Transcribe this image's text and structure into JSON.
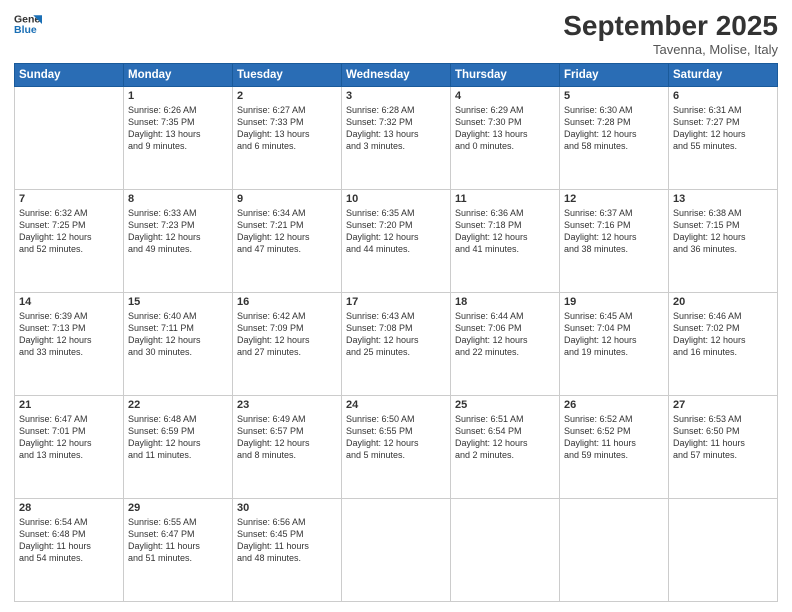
{
  "logo": {
    "line1": "General",
    "line2": "Blue"
  },
  "title": "September 2025",
  "subtitle": "Tavenna, Molise, Italy",
  "days_of_week": [
    "Sunday",
    "Monday",
    "Tuesday",
    "Wednesday",
    "Thursday",
    "Friday",
    "Saturday"
  ],
  "weeks": [
    [
      {
        "day": "",
        "info": ""
      },
      {
        "day": "1",
        "info": "Sunrise: 6:26 AM\nSunset: 7:35 PM\nDaylight: 13 hours\nand 9 minutes."
      },
      {
        "day": "2",
        "info": "Sunrise: 6:27 AM\nSunset: 7:33 PM\nDaylight: 13 hours\nand 6 minutes."
      },
      {
        "day": "3",
        "info": "Sunrise: 6:28 AM\nSunset: 7:32 PM\nDaylight: 13 hours\nand 3 minutes."
      },
      {
        "day": "4",
        "info": "Sunrise: 6:29 AM\nSunset: 7:30 PM\nDaylight: 13 hours\nand 0 minutes."
      },
      {
        "day": "5",
        "info": "Sunrise: 6:30 AM\nSunset: 7:28 PM\nDaylight: 12 hours\nand 58 minutes."
      },
      {
        "day": "6",
        "info": "Sunrise: 6:31 AM\nSunset: 7:27 PM\nDaylight: 12 hours\nand 55 minutes."
      }
    ],
    [
      {
        "day": "7",
        "info": "Sunrise: 6:32 AM\nSunset: 7:25 PM\nDaylight: 12 hours\nand 52 minutes."
      },
      {
        "day": "8",
        "info": "Sunrise: 6:33 AM\nSunset: 7:23 PM\nDaylight: 12 hours\nand 49 minutes."
      },
      {
        "day": "9",
        "info": "Sunrise: 6:34 AM\nSunset: 7:21 PM\nDaylight: 12 hours\nand 47 minutes."
      },
      {
        "day": "10",
        "info": "Sunrise: 6:35 AM\nSunset: 7:20 PM\nDaylight: 12 hours\nand 44 minutes."
      },
      {
        "day": "11",
        "info": "Sunrise: 6:36 AM\nSunset: 7:18 PM\nDaylight: 12 hours\nand 41 minutes."
      },
      {
        "day": "12",
        "info": "Sunrise: 6:37 AM\nSunset: 7:16 PM\nDaylight: 12 hours\nand 38 minutes."
      },
      {
        "day": "13",
        "info": "Sunrise: 6:38 AM\nSunset: 7:15 PM\nDaylight: 12 hours\nand 36 minutes."
      }
    ],
    [
      {
        "day": "14",
        "info": "Sunrise: 6:39 AM\nSunset: 7:13 PM\nDaylight: 12 hours\nand 33 minutes."
      },
      {
        "day": "15",
        "info": "Sunrise: 6:40 AM\nSunset: 7:11 PM\nDaylight: 12 hours\nand 30 minutes."
      },
      {
        "day": "16",
        "info": "Sunrise: 6:42 AM\nSunset: 7:09 PM\nDaylight: 12 hours\nand 27 minutes."
      },
      {
        "day": "17",
        "info": "Sunrise: 6:43 AM\nSunset: 7:08 PM\nDaylight: 12 hours\nand 25 minutes."
      },
      {
        "day": "18",
        "info": "Sunrise: 6:44 AM\nSunset: 7:06 PM\nDaylight: 12 hours\nand 22 minutes."
      },
      {
        "day": "19",
        "info": "Sunrise: 6:45 AM\nSunset: 7:04 PM\nDaylight: 12 hours\nand 19 minutes."
      },
      {
        "day": "20",
        "info": "Sunrise: 6:46 AM\nSunset: 7:02 PM\nDaylight: 12 hours\nand 16 minutes."
      }
    ],
    [
      {
        "day": "21",
        "info": "Sunrise: 6:47 AM\nSunset: 7:01 PM\nDaylight: 12 hours\nand 13 minutes."
      },
      {
        "day": "22",
        "info": "Sunrise: 6:48 AM\nSunset: 6:59 PM\nDaylight: 12 hours\nand 11 minutes."
      },
      {
        "day": "23",
        "info": "Sunrise: 6:49 AM\nSunset: 6:57 PM\nDaylight: 12 hours\nand 8 minutes."
      },
      {
        "day": "24",
        "info": "Sunrise: 6:50 AM\nSunset: 6:55 PM\nDaylight: 12 hours\nand 5 minutes."
      },
      {
        "day": "25",
        "info": "Sunrise: 6:51 AM\nSunset: 6:54 PM\nDaylight: 12 hours\nand 2 minutes."
      },
      {
        "day": "26",
        "info": "Sunrise: 6:52 AM\nSunset: 6:52 PM\nDaylight: 11 hours\nand 59 minutes."
      },
      {
        "day": "27",
        "info": "Sunrise: 6:53 AM\nSunset: 6:50 PM\nDaylight: 11 hours\nand 57 minutes."
      }
    ],
    [
      {
        "day": "28",
        "info": "Sunrise: 6:54 AM\nSunset: 6:48 PM\nDaylight: 11 hours\nand 54 minutes."
      },
      {
        "day": "29",
        "info": "Sunrise: 6:55 AM\nSunset: 6:47 PM\nDaylight: 11 hours\nand 51 minutes."
      },
      {
        "day": "30",
        "info": "Sunrise: 6:56 AM\nSunset: 6:45 PM\nDaylight: 11 hours\nand 48 minutes."
      },
      {
        "day": "",
        "info": ""
      },
      {
        "day": "",
        "info": ""
      },
      {
        "day": "",
        "info": ""
      },
      {
        "day": "",
        "info": ""
      }
    ]
  ]
}
